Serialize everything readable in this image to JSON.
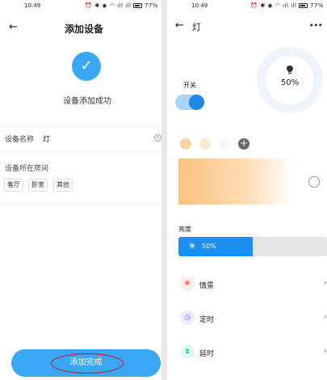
{
  "left": {
    "status": {
      "time": "10:49",
      "icons": "⏰ ✱ ◉ ◠ ıll ıll",
      "battery": "77%"
    },
    "header": {
      "back": "←",
      "title": "添加设备"
    },
    "success": {
      "check": "✓",
      "text": "设备添加成功"
    },
    "name_field": {
      "label": "设备名称",
      "value": "灯",
      "clear": "×"
    },
    "room": {
      "label": "设备所在房间",
      "options": [
        "客厅",
        "卧室",
        "其他"
      ]
    },
    "finish_button": "添加完成"
  },
  "right": {
    "status": {
      "time": "10:49",
      "icons": "⏰ ✱ ◉ ◠ ıll ıll",
      "battery": "77%"
    },
    "header": {
      "back": "←",
      "title": "灯",
      "more": "•••"
    },
    "power": {
      "label": "开关",
      "on": true
    },
    "brightness_dial": {
      "percent_text": "50%"
    },
    "colors": {
      "swatches": [
        "#f9d3a4",
        "#fdebcf",
        "#f7f7f9"
      ],
      "add": "+"
    },
    "brightness": {
      "label": "亮度",
      "value_text": "50%",
      "value": 0.5
    },
    "menu": [
      {
        "icon": "scene-icon",
        "glyph": "✺",
        "label": "情景",
        "color": "#ff6b5b"
      },
      {
        "icon": "timer-icon",
        "glyph": "◷",
        "label": "定时",
        "color": "#7b6cf6"
      },
      {
        "icon": "delay-icon",
        "glyph": "⧗",
        "label": "延时",
        "color": "#2fc7a8"
      }
    ],
    "chevron": "›"
  }
}
